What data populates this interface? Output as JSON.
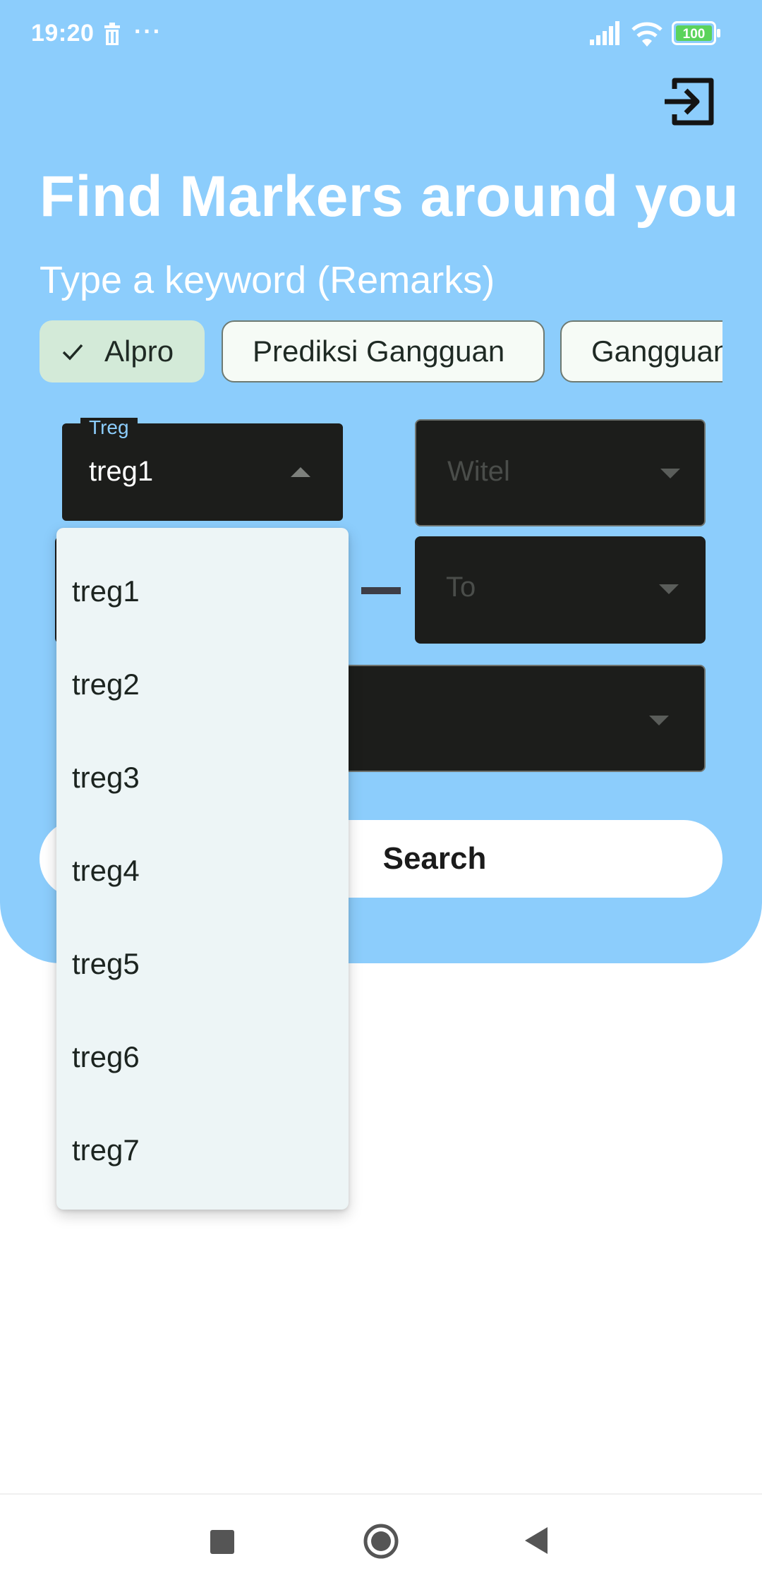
{
  "status_bar": {
    "time": "19:20",
    "dots": "···",
    "battery": "100"
  },
  "header": {
    "title": "Find Markers around you",
    "keyword_label": "Type a keyword (Remarks)"
  },
  "chips": [
    {
      "label": "Alpro",
      "selected": true
    },
    {
      "label": "Prediksi Gangguan",
      "selected": false
    },
    {
      "label": "Gangguan",
      "selected": false
    }
  ],
  "filters": {
    "treg": {
      "label": "Treg",
      "value": "treg1"
    },
    "witel": {
      "placeholder": "Witel"
    },
    "to": {
      "placeholder": "To"
    }
  },
  "search_button": {
    "label": "Search"
  },
  "dropdown": {
    "items": [
      "treg1",
      "treg2",
      "treg3",
      "treg4",
      "treg5",
      "treg6",
      "treg7"
    ]
  },
  "colors": {
    "header_bg": "#8ccdfc",
    "field_bg": "#1c1d1b",
    "chip_selected_bg": "#d3ead8",
    "menu_bg": "#edf5f6"
  },
  "icons": {
    "logout": "logout-icon",
    "check": "check-icon",
    "nav_recents": "square-icon",
    "nav_home": "circle-icon",
    "nav_back": "triangle-back-icon"
  }
}
